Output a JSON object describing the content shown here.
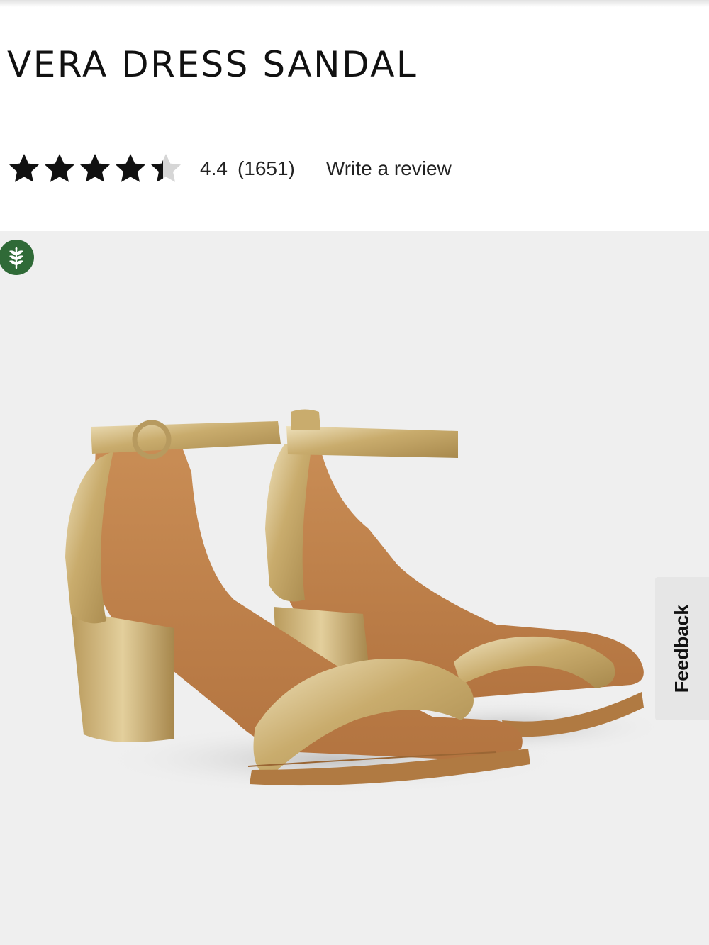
{
  "product": {
    "title": "VERA DRESS SANDAL"
  },
  "rating": {
    "value": "4.4",
    "count": "(1651)",
    "stars_filled": 4.4,
    "stars_total": 5,
    "write_review_label": "Write a review"
  },
  "badges": {
    "eco_icon": "leaf-wheat-icon"
  },
  "feedback": {
    "label": "Feedback"
  },
  "colors": {
    "star": "#111111",
    "star_empty": "#d6d6d6",
    "eco_badge": "#2f6a37",
    "image_background": "#efefef"
  }
}
